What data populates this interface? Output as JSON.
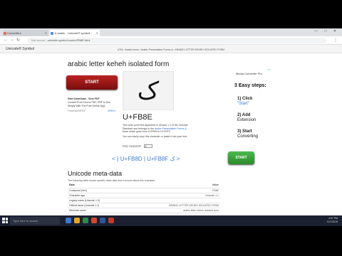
{
  "browser": {
    "tabs": [
      {
        "label": "Converters"
      },
      {
        "label": "ك arabic - Unicode® symbol - "
      }
    ],
    "address": {
      "site_label": "Not secure",
      "url": "unicode-symbol.com/u/FB8E.html"
    },
    "window_controls": "— □ ✕"
  },
  "site": {
    "logo": "Unicode® Symbol",
    "breadcrumb": "UTM › Arabic forms / Arabic Presentation Forms-A › ARABIC LETTER KEHEH ISOLATED FORM"
  },
  "main": {
    "title": "arabic letter keheh isolated form",
    "start_label": "START",
    "glyph": "ک",
    "codepoint": "U+FB8E",
    "description": "This code point first appeared in version 1.1 of the Unicode Standard and belongs to the ",
    "description_link": "Arabic Presentation Forms-A",
    "description_end": " block which goes from U+FB50 to U+FDFF.",
    "copy_hint": "You can easily copy this character or paste it into your text.",
    "insert_label": "Easy copy/paste:",
    "insert_value": "ک",
    "prev_link": "< ) U+FB8D",
    "separator": "|",
    "next_link": "U+FB8F ک >"
  },
  "ad_small": {
    "headline": "Start Download - View PDF",
    "body": "Convert From Doc to PDF, PDF to Doc Simply With The Free Online App!",
    "source": "FromDocToPDF",
    "open_label": "OPEN ›"
  },
  "ad_right": {
    "title": "Media Converter Pro",
    "steps_head": "3 Easy steps:",
    "step1_num": "1) Click",
    "step1_text": "\"Start\"",
    "step2_num": "2) Add",
    "step2_text": "Extension",
    "step3_num": "3) Start",
    "step3_text": "Converting",
    "start_label": "START",
    "ad_mark": "▷✕"
  },
  "meta": {
    "title": "Unicode meta-data",
    "subtitle": "The following table shows specific meta data that is known about this character.",
    "header": {
      "key": "Data",
      "value": "Value"
    },
    "rows": [
      {
        "key": "Codepoint (hex)",
        "value": "FB8E"
      },
      {
        "key": "Character age",
        "value": "Unicode 1.1"
      },
      {
        "key": "Legacy name (Unicode 1.0)",
        "value": ""
      },
      {
        "key": "Official name (Unicode 1.1)",
        "value": "ARABIC LETTER KEHEH ISOLATED FORM"
      },
      {
        "key": "Alternate name",
        "value": "arabic letter keheh isolated form"
      }
    ]
  },
  "taskbar": {
    "search_placeholder": "Type here to search",
    "time": "4:57 PM",
    "date": "11/7/2019"
  }
}
